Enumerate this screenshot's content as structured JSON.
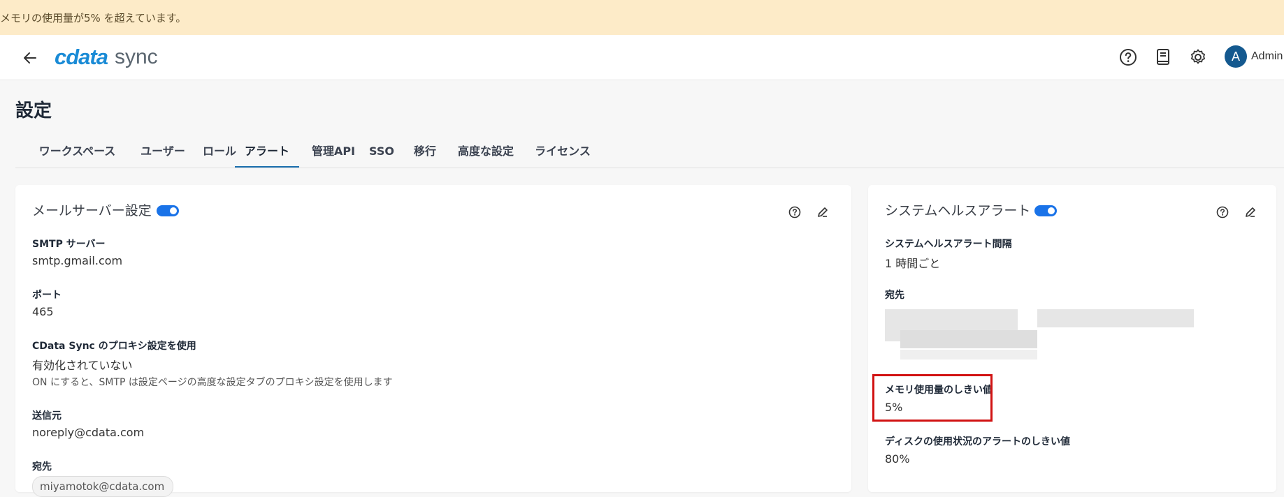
{
  "banner": {
    "text": "メモリの使用量が5% を超えています。"
  },
  "header": {
    "logo_main": "cdata",
    "logo_sub": "sync",
    "user_initial": "A",
    "user_name": "Admin"
  },
  "page": {
    "title": "設定"
  },
  "tabs": [
    {
      "label": "ワークスペース"
    },
    {
      "label": "ユーザー"
    },
    {
      "label": "ロール"
    },
    {
      "label": "アラート"
    },
    {
      "label": "管理API"
    },
    {
      "label": "SSO"
    },
    {
      "label": "移行"
    },
    {
      "label": "高度な設定"
    },
    {
      "label": "ライセンス"
    }
  ],
  "mail_card": {
    "title": "メールサーバー設定",
    "smtp_label": "SMTP サーバー",
    "smtp_value": "smtp.gmail.com",
    "port_label": "ポート",
    "port_value": "465",
    "proxy_label": "CData Sync のプロキシ設定を使用",
    "proxy_value": "有効化されていない",
    "proxy_hint": "ON にすると、SMTP は設定ページの高度な設定タブのプロキシ設定を使用します",
    "from_label": "送信元",
    "from_value": "noreply@cdata.com",
    "to_label": "宛先",
    "to_chip": "miyamotok@cdata.com"
  },
  "health_card": {
    "title": "システムヘルスアラート",
    "interval_label": "システムヘルスアラート間隔",
    "interval_value": "1 時間ごと",
    "to_label": "宛先",
    "memory_label": "メモリ使用量のしきい値",
    "memory_value": "5%",
    "disk_label": "ディスクの使用状況のアラートのしきい値",
    "disk_value": "80%"
  },
  "colors": {
    "accent": "#1a73e8",
    "banner_bg": "#fdebc8",
    "highlight": "#d11212",
    "logo_blue": "#1a8bd6",
    "avatar_bg": "#14598f"
  }
}
